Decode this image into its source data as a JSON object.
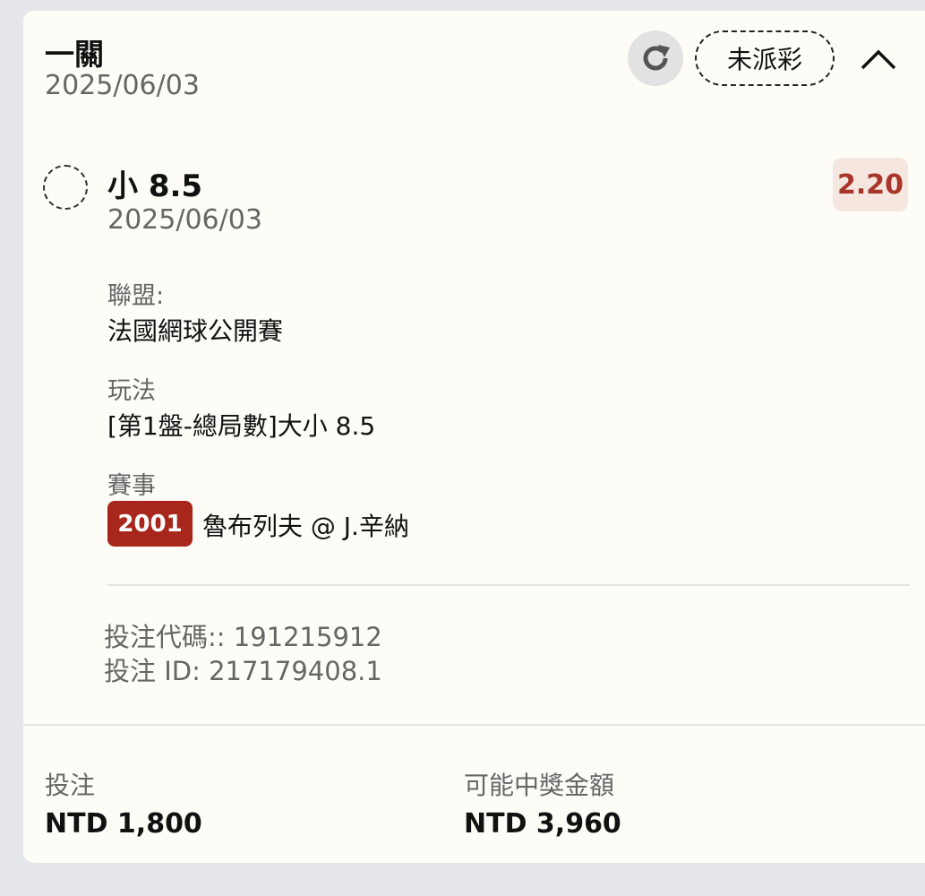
{
  "header": {
    "title": "一關",
    "date": "2025/06/03",
    "status_label": "未派彩"
  },
  "selection": {
    "name": "小 8.5",
    "date": "2025/06/03",
    "odds": "2.20"
  },
  "details": {
    "league_label": "聯盟:",
    "league_value": "法國網球公開賽",
    "market_label": "玩法",
    "market_value": "[第1盤-總局數]大小 8.5",
    "event_label": "賽事",
    "event_code": "2001",
    "event_name": "魯布列夫 @ J.辛納"
  },
  "codes": {
    "bet_code": "投注代碼:: 191215912",
    "bet_id": "投注 ID: 217179408.1"
  },
  "footer": {
    "stake_label": "投注",
    "stake_value": "NTD 1,800",
    "payout_label": "可能中獎金額",
    "payout_value": "NTD 3,960"
  },
  "colors": {
    "accent_red": "#a8261c",
    "odds_text": "#a8352a",
    "odds_bg": "#f5e6e0",
    "card_bg": "#fdfcf6",
    "page_bg": "#e6e7ea"
  },
  "icons": {
    "refresh": "refresh-icon",
    "collapse": "chevron-up-icon",
    "radio": "radio-unselected-icon"
  }
}
